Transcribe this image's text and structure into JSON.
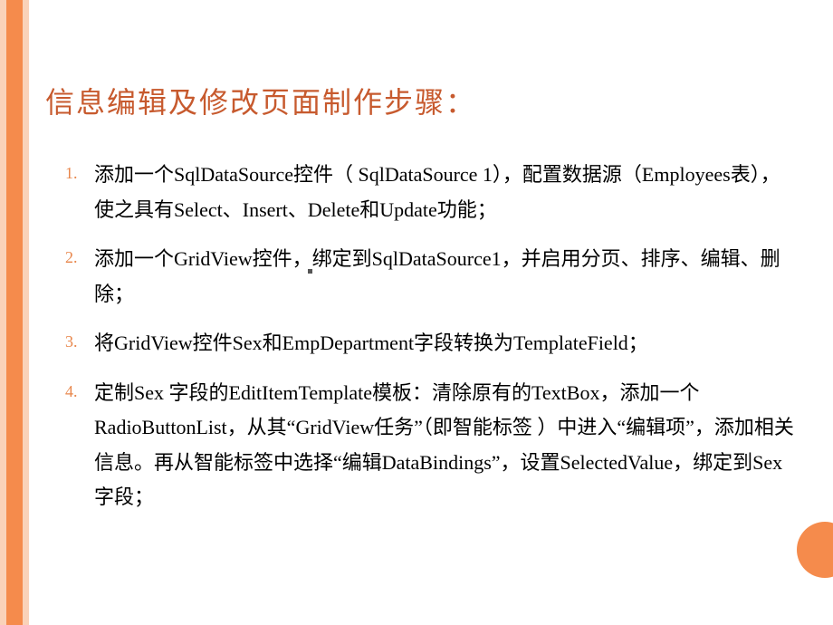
{
  "title": "信息编辑及修改页面制作步骤：",
  "items": [
    "添加一个SqlDataSource控件（ SqlDataSource 1），配置数据源（Employees表），使之具有Select、Insert、Delete和Update功能；",
    "添加一个GridView控件，绑定到SqlDataSource1，并启用分页、排序、编辑、删除；",
    "将GridView控件Sex和EmpDepartment字段转换为TemplateField；",
    "定制Sex 字段的EditItemTemplate模板：清除原有的TextBox，添加一个RadioButtonList，从其“GridView任务”（即智能标签 ）中进入“编辑项”，添加相关信息。再从智能标签中选择“编辑DataBindings”，设置SelectedValue，绑定到Sex字段；"
  ]
}
